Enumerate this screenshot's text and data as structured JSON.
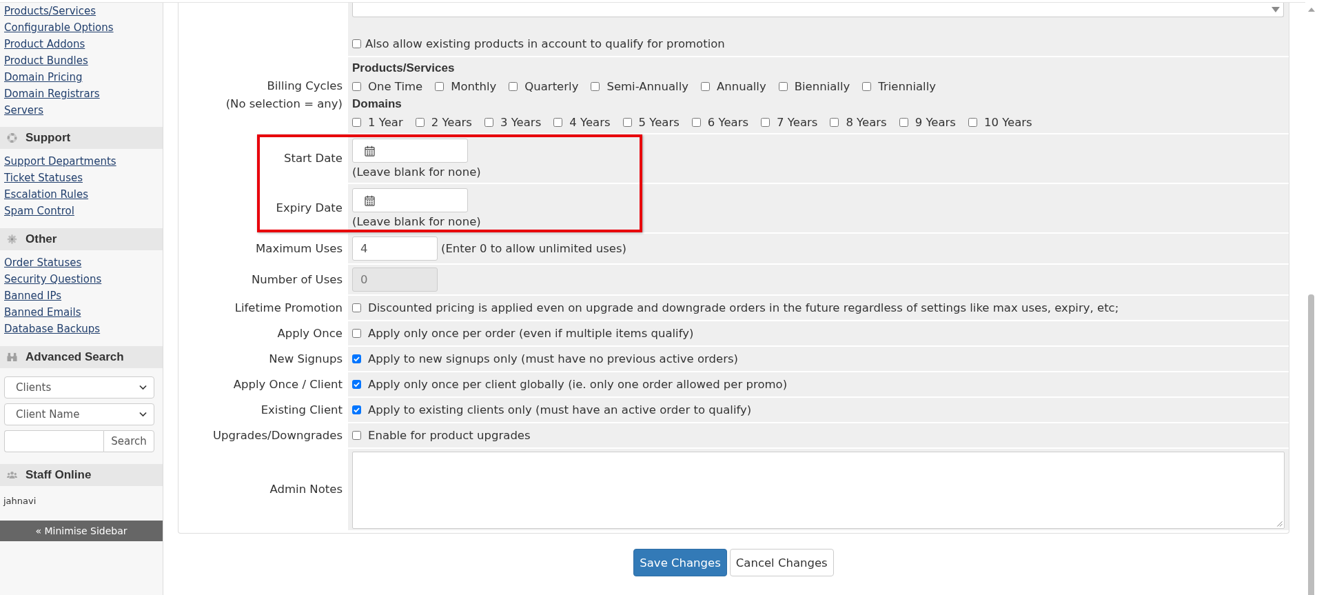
{
  "sidebar": {
    "panels": [
      {
        "kind": "links",
        "links": [
          "Products/Services",
          "Configurable Options",
          "Product Addons",
          "Product Bundles",
          "Domain Pricing",
          "Domain Registrars",
          "Servers"
        ]
      },
      {
        "kind": "links",
        "title": "Support",
        "links": [
          "Support Departments",
          "Ticket Statuses",
          "Escalation Rules",
          "Spam Control"
        ]
      },
      {
        "kind": "links",
        "title": "Other",
        "links": [
          "Order Statuses",
          "Security Questions",
          "Banned IPs",
          "Banned Emails",
          "Database Backups"
        ]
      },
      {
        "kind": "search",
        "title": "Advanced Search",
        "selects": [
          "Clients",
          "Client Name"
        ],
        "button": "Search"
      },
      {
        "kind": "staff",
        "title": "Staff Online",
        "staff": [
          "jahnavi"
        ]
      }
    ],
    "minimise_button": "« Minimise Sidebar"
  },
  "form": {
    "rows": [
      {
        "kind": "select_checkbox",
        "highlighted": false,
        "checkbox": {
          "label": "Also allow existing products in account to qualify for promotion",
          "checked": false
        }
      },
      {
        "kind": "cycles",
        "highlighted": false,
        "label": "Billing Cycles",
        "sublabel": "(No selection = any)",
        "groups": [
          {
            "title": "Products/Services",
            "options": [
              {
                "label": "One Time",
                "checked": false
              },
              {
                "label": "Monthly",
                "checked": false
              },
              {
                "label": "Quarterly",
                "checked": false
              },
              {
                "label": "Semi-Annually",
                "checked": false
              },
              {
                "label": "Annually",
                "checked": false
              },
              {
                "label": "Biennially",
                "checked": false
              },
              {
                "label": "Triennially",
                "checked": false
              }
            ]
          },
          {
            "title": "Domains",
            "options": [
              {
                "label": "1 Year",
                "checked": false
              },
              {
                "label": "2 Years",
                "checked": false
              },
              {
                "label": "3 Years",
                "checked": false
              },
              {
                "label": "4 Years",
                "checked": false
              },
              {
                "label": "5 Years",
                "checked": false
              },
              {
                "label": "6 Years",
                "checked": false
              },
              {
                "label": "7 Years",
                "checked": false
              },
              {
                "label": "8 Years",
                "checked": false
              },
              {
                "label": "9 Years",
                "checked": false
              },
              {
                "label": "10 Years",
                "checked": false
              }
            ]
          }
        ]
      },
      {
        "kind": "date",
        "highlighted": true,
        "label": "Start Date",
        "hint": "(Leave blank for none)"
      },
      {
        "kind": "date",
        "highlighted": true,
        "label": "Expiry Date",
        "hint": "(Leave blank for none)"
      },
      {
        "kind": "number",
        "highlighted": false,
        "label": "Maximum Uses",
        "value": "4",
        "disabled": false,
        "hint": "(Enter 0 to allow unlimited uses)"
      },
      {
        "kind": "number",
        "highlighted": false,
        "label": "Number of Uses",
        "value": "0",
        "disabled": true
      },
      {
        "kind": "checkbox",
        "highlighted": false,
        "label": "Lifetime Promotion",
        "text": "Discounted pricing is applied even on upgrade and downgrade orders in the future regardless of settings like max uses, expiry, etc;",
        "checked": false
      },
      {
        "kind": "checkbox",
        "highlighted": false,
        "label": "Apply Once",
        "text": "Apply only once per order (even if multiple items qualify)",
        "checked": false
      },
      {
        "kind": "checkbox",
        "highlighted": false,
        "label": "New Signups",
        "text": "Apply to new signups only (must have no previous active orders)",
        "checked": true
      },
      {
        "kind": "checkbox",
        "highlighted": false,
        "label": "Apply Once / Client",
        "text": "Apply only once per client globally (ie. only one order allowed per promo)",
        "checked": true
      },
      {
        "kind": "checkbox",
        "highlighted": false,
        "label": "Existing Client",
        "text": "Apply to existing clients only (must have an active order to qualify)",
        "checked": true
      },
      {
        "kind": "checkbox",
        "highlighted": false,
        "label": "Upgrades/Downgrades",
        "text": "Enable for product upgrades",
        "checked": false
      },
      {
        "kind": "textarea",
        "highlighted": false,
        "label": "Admin Notes"
      }
    ]
  },
  "buttons": [
    {
      "label": "Save Changes",
      "kind": "primary"
    },
    {
      "label": "Cancel Changes",
      "kind": "default"
    }
  ]
}
